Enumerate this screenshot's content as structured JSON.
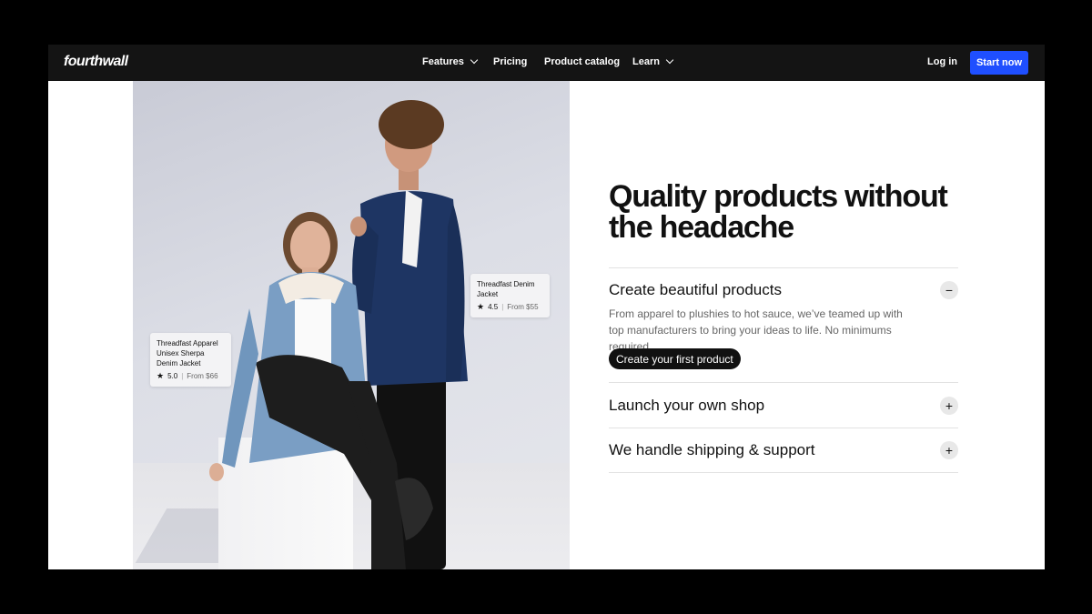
{
  "header": {
    "logo": "fourthwall",
    "nav": [
      {
        "label": "Features",
        "dropdown": true
      },
      {
        "label": "Pricing",
        "dropdown": false
      },
      {
        "label": "Product catalog",
        "dropdown": false
      },
      {
        "label": "Learn",
        "dropdown": true
      }
    ],
    "login": "Log in",
    "start": "Start now"
  },
  "colors": {
    "accent": "#1f4fff",
    "header_bg": "#141414"
  },
  "photo": {
    "tags": [
      {
        "title": "Threadfast Apparel Unisex Sherpa Denim Jacket",
        "rating": "5.0",
        "price": "From $66"
      },
      {
        "title": "Threadfast Denim Jacket",
        "rating": "4.5",
        "price": "From $55"
      }
    ]
  },
  "main": {
    "headline": "Quality products without the headache",
    "accordion": [
      {
        "title": "Create beautiful products",
        "expanded": true,
        "icon": "minus-icon",
        "description": "From apparel to plushies to hot sauce, we’ve teamed up with top manufacturers to bring your ideas to life. No minimums required.",
        "cta": "Create your first product"
      },
      {
        "title": "Launch your own shop",
        "expanded": false,
        "icon": "plus-icon"
      },
      {
        "title": "We handle shipping & support",
        "expanded": false,
        "icon": "plus-icon"
      }
    ]
  }
}
